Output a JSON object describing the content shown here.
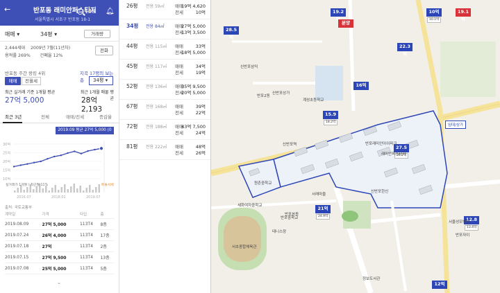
{
  "header": {
    "title": "반포동 래미안퍼스티지",
    "address": "서울특별시 서초구 반포동 18-1",
    "notification_count": "148"
  },
  "filters": {
    "trade_type": "매매",
    "pyeong": "34평",
    "compare_label": "거래량"
  },
  "info": {
    "households": "2,444세대",
    "built": "2009년 7월(11년차)",
    "floor_area_ratio": "용적률 269%",
    "coverage_ratio": "건폐율 12%",
    "tel_label": "전화"
  },
  "trend": {
    "label": "반포동 주간 랑킹 4위",
    "link": "지곡 17평의 보는 층",
    "btn_sale": "매매",
    "btn_lease": "전월세",
    "pyeong_select": "34평",
    "avg_left_label": "최근 실거래 기준 1개월 평균",
    "avg_left_value": "27억 5,000",
    "avg_right_label": "최근 1개월 매물 평균",
    "avg_right_value": "28억 2,193"
  },
  "tabs": {
    "recent3y": "최근 3년",
    "all": "전체",
    "both": "매매/전세",
    "pyeong": "증감율"
  },
  "chart": {
    "badge": "2019.09 평균 27억 5,000 (0건)",
    "legend": "실거래가 1개월 / 최근월 11%",
    "right_label": "매물시세",
    "x_labels": [
      "2016.07",
      "2018.01",
      "2019.07"
    ],
    "y_labels": [
      "30억",
      "25억",
      "20억",
      "15억",
      "10억"
    ]
  },
  "chart_data": {
    "type": "line",
    "x": [
      "2016.07",
      "2016.10",
      "2017.01",
      "2017.04",
      "2017.07",
      "2017.10",
      "2018.01",
      "2018.04",
      "2018.07",
      "2018.10",
      "2019.01",
      "2019.04",
      "2019.07",
      "2019.09"
    ],
    "series": [
      {
        "values": [
          17.0,
          17.8,
          18.5,
          19.3,
          20.0,
          21.5,
          22.8,
          23.5,
          24.8,
          25.8,
          24.5,
          26.0,
          26.8,
          27.5
        ]
      }
    ],
    "ylim": [
      10,
      30
    ]
  },
  "transactions": {
    "source": "출처: 국토교통부",
    "headers": [
      "계약일",
      "가격",
      "타입",
      "층"
    ],
    "rows": [
      {
        "date": "2019.08.09",
        "price": "27억 5,000",
        "type": "113T4",
        "floor": "8층"
      },
      {
        "date": "2019.07.24",
        "price": "26억 4,000",
        "type": "113T4",
        "floor": "17층"
      },
      {
        "date": "2019.07.18",
        "price": "27억",
        "type": "113T4",
        "floor": "2층"
      },
      {
        "date": "2019.07.15",
        "price": "27억 9,500",
        "type": "113T4",
        "floor": "13층"
      },
      {
        "date": "2019.07.08",
        "price": "25억 5,000",
        "type": "113T4",
        "floor": "5층"
      }
    ]
  },
  "listing": [
    {
      "pyeong": "26평",
      "area": "전용 59㎡",
      "l1": "매매",
      "v1": "19억 4,620",
      "l2": "전세",
      "v2": "10억",
      "hl": false
    },
    {
      "pyeong": "34평",
      "area": "전용 84㎡",
      "l1": "매매",
      "v1": "27억 5,000",
      "l2": "전세",
      "v2": "13억 3,500",
      "hl": true
    },
    {
      "pyeong": "44평",
      "area": "전용 115㎡",
      "l1": "매매",
      "v1": "33억",
      "l2": "전세",
      "v2": "18억 5,000",
      "hl": false
    },
    {
      "pyeong": "45평",
      "area": "전용 117㎡",
      "l1": "매매",
      "v1": "34억",
      "l2": "전세",
      "v2": "19억",
      "hl": false
    },
    {
      "pyeong": "52평",
      "area": "전용 136㎡",
      "l1": "매매",
      "v1": "35억 9,500",
      "l2": "전세",
      "v2": "20억 5,000",
      "hl": false
    },
    {
      "pyeong": "67평",
      "area": "전용 168㎡",
      "l1": "매매",
      "v1": "39억",
      "l2": "전세",
      "v2": "22억",
      "hl": false
    },
    {
      "pyeong": "72평",
      "area": "전용 188㎡",
      "l1": "매매",
      "v1": "43억 7,500",
      "l2": "전세",
      "v2": "24억",
      "hl": false
    },
    {
      "pyeong": "81평",
      "area": "전용 222㎡",
      "l1": "매매",
      "v1": "48억",
      "l2": "전세",
      "v2": "26억",
      "hl": false
    }
  ],
  "map": {
    "pins": [
      {
        "label": "19.2억",
        "sub": "",
        "color": "blue"
      },
      {
        "label": "분양",
        "sub": "",
        "color": "red"
      },
      {
        "label": "10억",
        "sub": "10.1억",
        "color": "blue"
      },
      {
        "label": "19.1억",
        "sub": "",
        "color": "red"
      },
      {
        "label": "28.5억",
        "sub": "",
        "color": "blue"
      },
      {
        "label": "22.3억",
        "sub": "",
        "color": "blue"
      },
      {
        "label": "16억",
        "sub": "",
        "color": "blue"
      },
      {
        "label": "15.9억",
        "sub": "18.2억",
        "color": "blue"
      },
      {
        "label": "27.5억",
        "sub": "28.2억",
        "color": "blue"
      },
      {
        "label": "21억",
        "sub": "24.9억",
        "color": "blue"
      },
      {
        "label": "12.8억",
        "sub": "13.4억",
        "color": "blue"
      },
      {
        "label": "12억",
        "sub": "",
        "color": "blue"
      }
    ],
    "labels": [
      "신반포삼익",
      "반포2동",
      "신반포상가",
      "계성초등학교",
      "신반포역",
      "반포래미안아이파크",
      "서래마을",
      "반포본동",
      "테니스장",
      "서초종합체육관",
      "원촌중학교",
      "신반포한신",
      "세화여자중학교",
      "반포중학교",
      "래미안퍼스티지",
      "반포자이",
      "서울성모병원",
      "정보도서관"
    ],
    "building_label": "임대/상가"
  }
}
